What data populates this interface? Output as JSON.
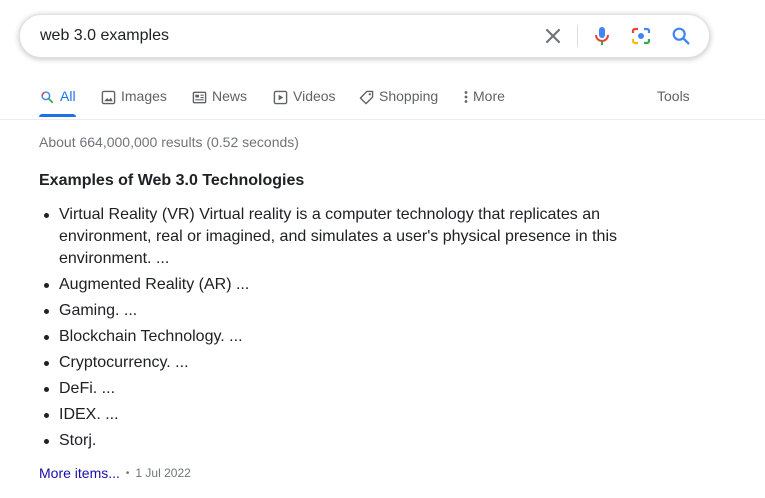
{
  "search": {
    "query": "web 3.0 examples"
  },
  "tabs": [
    {
      "label": "All",
      "icon": "search-icon",
      "active": true
    },
    {
      "label": "Images",
      "icon": "image-icon"
    },
    {
      "label": "News",
      "icon": "newspaper-icon"
    },
    {
      "label": "Videos",
      "icon": "play-icon"
    },
    {
      "label": "Shopping",
      "icon": "tag-icon"
    },
    {
      "label": "More",
      "icon": "more-vert-icon"
    }
  ],
  "tools_label": "Tools",
  "results": {
    "stats": "About 664,000,000 results (0.52 seconds)",
    "snippet": {
      "title": "Examples of Web 3.0 Technologies",
      "items": [
        "Virtual Reality (VR) Virtual reality is a computer technology that replicates an environment, real or imagined, and simulates a user's physical presence in this environment. ...",
        "Augmented Reality (AR) ...",
        "Gaming. ...",
        "Blockchain Technology. ...",
        "Cryptocurrency. ...",
        "DeFi. ...",
        "IDEX. ...",
        "Storj."
      ],
      "more_items": "More items...",
      "separator": "•",
      "date": "1 Jul 2022"
    }
  },
  "colors": {
    "accent": "#1a73e8",
    "link": "#1a0dab",
    "muted": "#70757a",
    "mic_red": "#ea4335",
    "google_yellow": "#fbbc04",
    "google_green": "#34a853"
  }
}
